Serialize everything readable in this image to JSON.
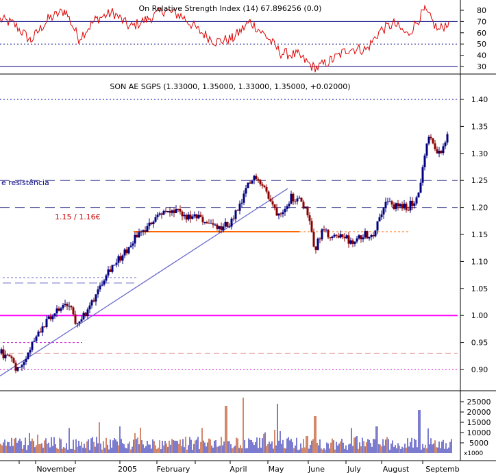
{
  "colors": {
    "background": "#ffffff",
    "up_bar": "#000080",
    "down_bar": "#8b0000",
    "rsi_line": "#dd0000",
    "blue_guides": "#00007f",
    "magenta_line": "#ff00ff",
    "orange_line": "#ff6600",
    "trend_line": "#6a6acd",
    "volume_up": "#7b7bcf",
    "volume_down": "#d2886a"
  },
  "rsi_panel": {
    "title_overlap": "On Relative Strength Index (14) 67.896256 (0.0)",
    "y_ticks": [
      "80",
      "70",
      "60",
      "50",
      "40",
      "30"
    ],
    "levels": {
      "upper": 70,
      "mid": 50,
      "lower": 30
    }
  },
  "price_panel": {
    "title": "SON AE SGPS (1.33000, 1.35000, 1.33000, 1.35000, +0.02000)",
    "y_ticks": [
      "1.40",
      "1.35",
      "1.30",
      "1.25",
      "1.20",
      "1.15",
      "1.10",
      "1.05",
      "1.00",
      "0.95",
      "0.90"
    ],
    "annotation_resistance": "e resistência",
    "annotation_zone": "1.15 / 1.16€"
  },
  "volume_panel": {
    "y_ticks": [
      "25000",
      "20000",
      "15000",
      "10000",
      "5000"
    ],
    "unit_label": "x1000"
  },
  "x_axis": {
    "labels": [
      "November",
      "2005",
      "February",
      "April",
      "May",
      "June",
      "July",
      "August",
      "Septemb"
    ]
  },
  "chart_data": {
    "type": "ohlc",
    "title": "SON AE SGPS (1.33000, 1.35000, 1.33000, 1.35000, +0.02000)",
    "last_bar": {
      "open": 1.33,
      "high": 1.35,
      "low": 1.33,
      "close": 1.35,
      "change": 0.02
    },
    "ylim": [
      0.87,
      1.44
    ],
    "approx_close_path": [
      {
        "x": "October",
        "y": 0.92
      },
      {
        "x": "November",
        "y": 0.98
      },
      {
        "x": "December",
        "y": 1.05
      },
      {
        "x": "2005",
        "y": 1.12
      },
      {
        "x": "February",
        "y": 1.19
      },
      {
        "x": "March",
        "y": 1.17
      },
      {
        "x": "April",
        "y": 1.25
      },
      {
        "x": "May",
        "y": 1.2
      },
      {
        "x": "June",
        "y": 1.12
      },
      {
        "x": "July",
        "y": 1.14
      },
      {
        "x": "August",
        "y": 1.21
      },
      {
        "x": "Septemb",
        "y": 1.33
      }
    ],
    "reference_lines": [
      {
        "type": "dashed",
        "y": 1.4,
        "color": "#0000aa"
      },
      {
        "type": "dashed",
        "y": 1.25,
        "color": "#000080"
      },
      {
        "type": "dashed",
        "y": 1.2,
        "color": "#000080"
      },
      {
        "type": "solid",
        "y": 1.155,
        "color": "#ff6600"
      },
      {
        "type": "solid",
        "y": 1.0,
        "color": "#ff00ff"
      },
      {
        "type": "dashed",
        "y": 0.9,
        "color": "#cc00cc"
      }
    ],
    "trendline": {
      "from": {
        "x": "October",
        "y": 0.89
      },
      "to": {
        "x": "May",
        "y": 1.235
      }
    },
    "rsi": {
      "ylim": [
        20,
        85
      ],
      "levels": [
        70,
        50,
        30
      ],
      "last": 67.9
    },
    "volume": {
      "unit": "x1000",
      "ylim": [
        0,
        28000
      ],
      "peak": 27000
    }
  }
}
